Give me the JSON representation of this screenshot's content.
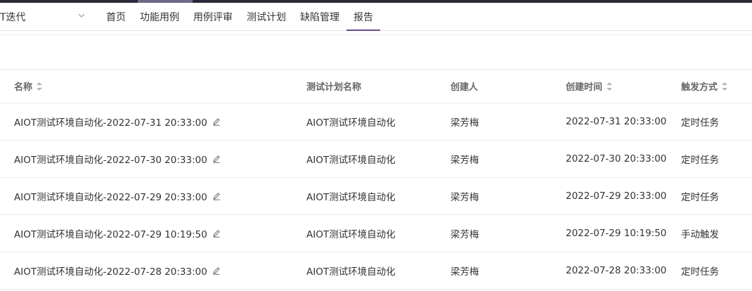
{
  "nav": {
    "iteration_label": "T迭代",
    "tabs": [
      {
        "label": "首页"
      },
      {
        "label": "功能用例"
      },
      {
        "label": "用例评审"
      },
      {
        "label": "测试计划"
      },
      {
        "label": "缺陷管理"
      },
      {
        "label": "报告",
        "active": true
      }
    ]
  },
  "table": {
    "columns": {
      "name": "名称",
      "plan": "测试计划名称",
      "creator": "创建人",
      "created_at": "创建时间",
      "trigger": "触发方式"
    },
    "rows": [
      {
        "name": "AIOT测试环境自动化-2022-07-31 20:33:00",
        "plan": "AIOT测试环境自动化",
        "creator": "梁芳梅",
        "created_at": "2022-07-31 20:33:00",
        "trigger": "定时任务"
      },
      {
        "name": "AIOT测试环境自动化-2022-07-30 20:33:00",
        "plan": "AIOT测试环境自动化",
        "creator": "梁芳梅",
        "created_at": "2022-07-30 20:33:00",
        "trigger": "定时任务"
      },
      {
        "name": "AIOT测试环境自动化-2022-07-29 20:33:00",
        "plan": "AIOT测试环境自动化",
        "creator": "梁芳梅",
        "created_at": "2022-07-29 20:33:00",
        "trigger": "定时任务"
      },
      {
        "name": "AIOT测试环境自动化-2022-07-29 10:19:50",
        "plan": "AIOT测试环境自动化",
        "creator": "梁芳梅",
        "created_at": "2022-07-29 10:19:50",
        "trigger": "手动触发"
      },
      {
        "name": "AIOT测试环境自动化-2022-07-28 20:33:00",
        "plan": "AIOT测试环境自动化",
        "creator": "梁芳梅",
        "created_at": "2022-07-28 20:33:00",
        "trigger": "定时任务"
      }
    ]
  }
}
